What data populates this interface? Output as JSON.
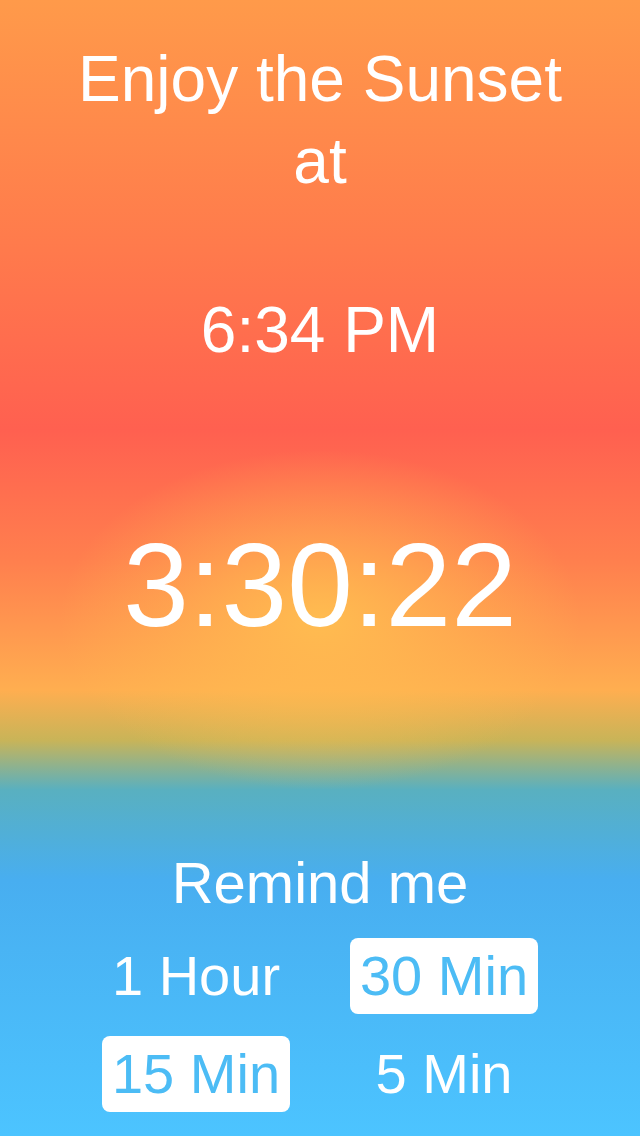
{
  "title": "Enjoy the Sunset at",
  "sunset_time": "6:34 PM",
  "countdown": "3:30:22",
  "reminder": {
    "label": "Remind me",
    "options": [
      {
        "label": "1 Hour",
        "selected": false
      },
      {
        "label": "30 Min",
        "selected": true
      },
      {
        "label": "15 Min",
        "selected": true
      },
      {
        "label": "5 Min",
        "selected": false
      }
    ]
  }
}
